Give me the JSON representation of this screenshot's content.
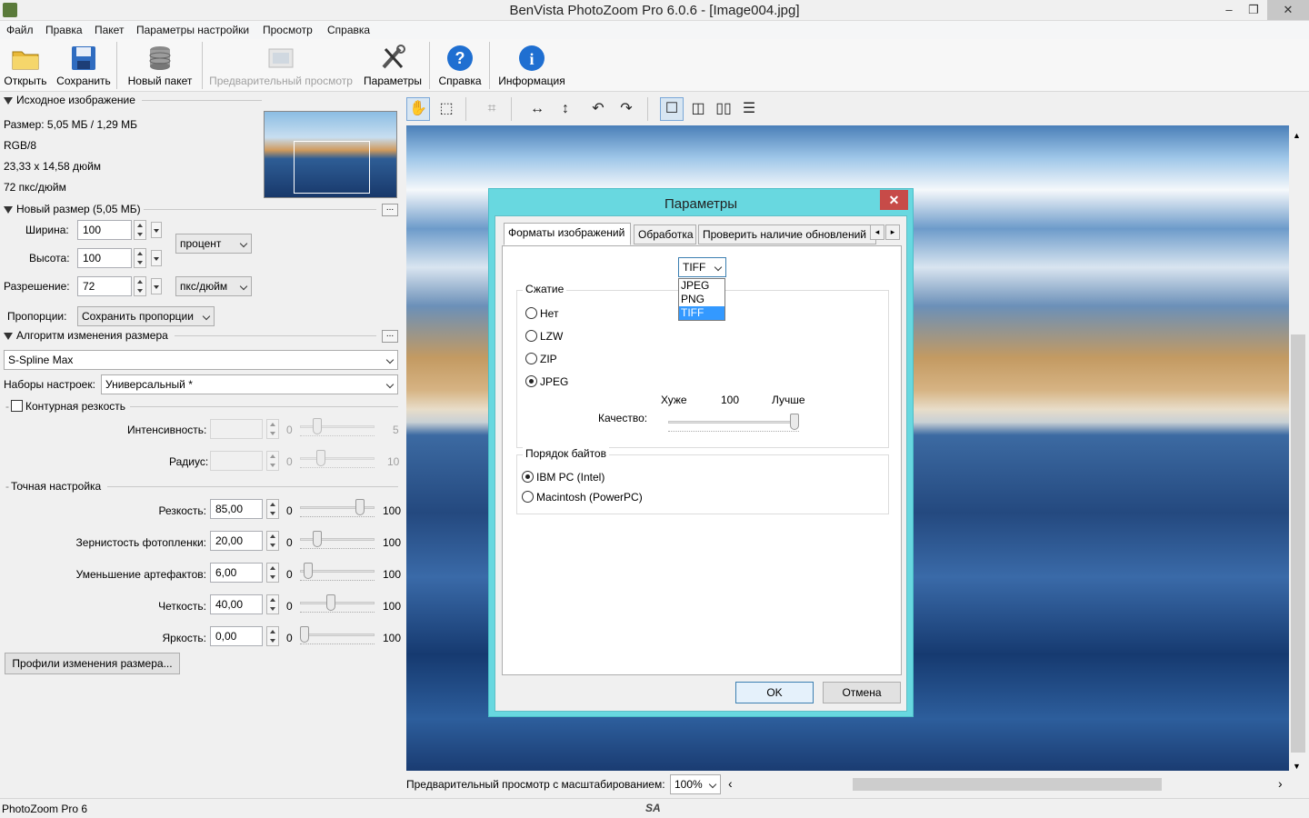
{
  "window": {
    "title": "BenVista PhotoZoom Pro 6.0.6 - [Image004.jpg]",
    "min": "–",
    "restore": "❐",
    "close": "✕"
  },
  "menu": [
    "Файл",
    "Правка",
    "Пакет",
    "Параметры настройки",
    "Просмотр",
    "Справка"
  ],
  "toolbar": {
    "open": "Открыть",
    "save": "Сохранить",
    "batch": "Новый пакет",
    "preview": "Предварительный просмотр",
    "settings": "Параметры",
    "help": "Справка",
    "info": "Информация"
  },
  "source": {
    "section": "Исходное изображение",
    "size": "Размер: 5,05 МБ / 1,29 МБ",
    "mode": "RGB/8",
    "dimensions": "23,33 x 14,58 дюйм",
    "dpi": "72 пкс/дюйм"
  },
  "new_size": {
    "section": "Новый размер (5,05 МБ)",
    "width_label": "Ширина:",
    "width_value": "100",
    "height_label": "Высота:",
    "height_value": "100",
    "unit": "процент",
    "resolution_label": "Разрешение:",
    "resolution_value": "72",
    "resolution_unit": "пкс/дюйм",
    "proportions_label": "Пропорции:",
    "proportions_value": "Сохранить пропорции"
  },
  "algorithm": {
    "section": "Алгоритм изменения размера",
    "method": "S-Spline Max",
    "presets_label": "Наборы настроек:",
    "presets_value": "Универсальный *"
  },
  "sharpness": {
    "checkbox": "Контурная резкость",
    "intensity_label": "Интенсивность:",
    "intensity_min": "0",
    "intensity_max": "5",
    "radius_label": "Радиус:",
    "radius_min": "0",
    "radius_max": "10"
  },
  "fine_tune": {
    "section": "Точная настройка",
    "rows": [
      {
        "label": "Резкость:",
        "value": "85,00",
        "min": "0",
        "max": "100",
        "level": 0.85
      },
      {
        "label": "Зернистость фотопленки:",
        "value": "20,00",
        "min": "0",
        "max": "100",
        "level": 0.2
      },
      {
        "label": "Уменьшение артефактов:",
        "value": "6,00",
        "min": "0",
        "max": "100",
        "level": 0.06
      },
      {
        "label": "Четкость:",
        "value": "40,00",
        "min": "0",
        "max": "100",
        "level": 0.4
      },
      {
        "label": "Яркость:",
        "value": "0,00",
        "min": "0",
        "max": "100",
        "level": 0.0
      }
    ],
    "profiles_button": "Профили изменения размера..."
  },
  "preview": {
    "label": "Предварительный просмотр с масштабированием:",
    "zoom": "100%"
  },
  "status": {
    "text": "PhotoZoom Pro 6",
    "logo": "SA"
  },
  "dialog": {
    "title": "Параметры",
    "close": "✕",
    "tabs": [
      "Форматы изображений",
      "Обработка",
      "Проверить наличие обновлений"
    ],
    "format_value": "TIFF",
    "format_options": [
      "JPEG",
      "PNG",
      "TIFF"
    ],
    "compression": {
      "title": "Сжатие",
      "options": [
        "Нет",
        "LZW",
        "ZIP",
        "JPEG"
      ],
      "selected": "JPEG",
      "quality_label": "Качество:",
      "worse": "Хуже",
      "quality_value": "100",
      "better": "Лучше",
      "quality_level": 1.0
    },
    "byte_order": {
      "title": "Порядок байтов",
      "options": [
        "IBM PC (Intel)",
        "Macintosh (PowerPC)"
      ],
      "selected": "IBM PC (Intel)"
    },
    "ok": "OK",
    "cancel": "Отмена"
  }
}
